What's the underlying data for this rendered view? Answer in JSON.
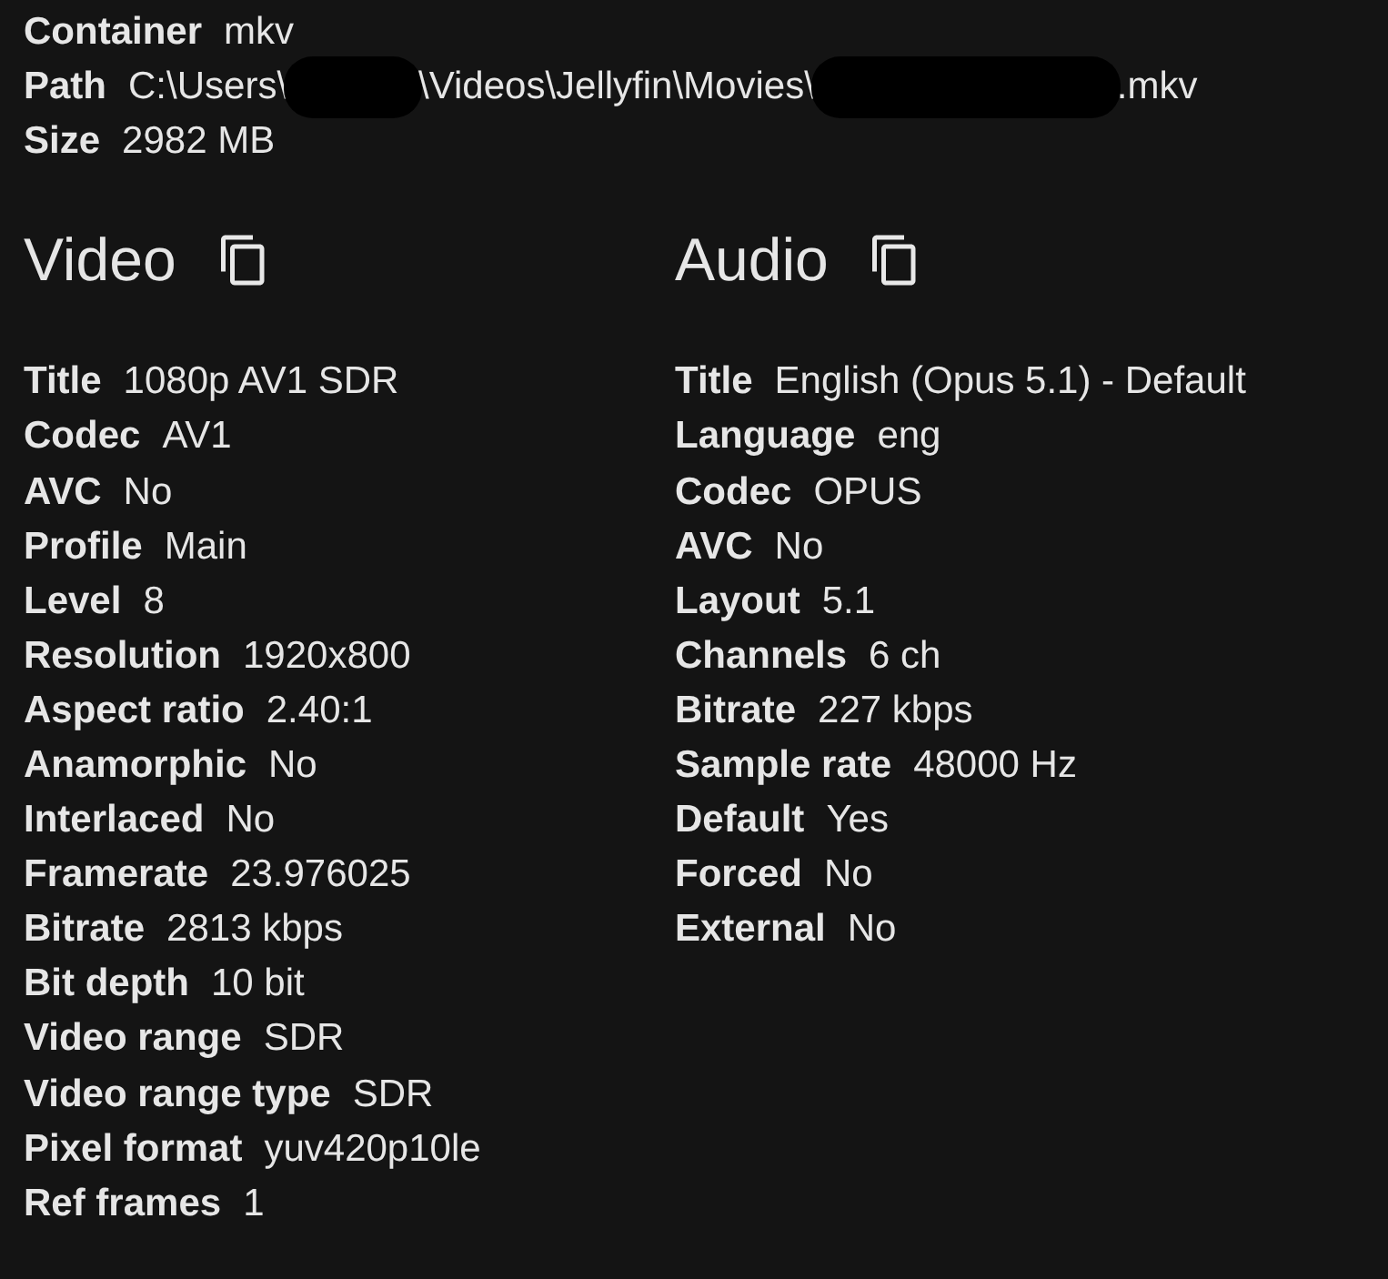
{
  "file_info": [
    {
      "label": "Container",
      "value": [
        {
          "kind": "text",
          "text": "mkv"
        }
      ]
    },
    {
      "label": "Path",
      "value": [
        {
          "kind": "text",
          "text": "C:\\Users\\"
        },
        {
          "kind": "redacted"
        },
        {
          "kind": "text",
          "text": "\\Videos\\Jellyfin\\Movies\\"
        },
        {
          "kind": "redacted"
        },
        {
          "kind": "text",
          "text": ".mkv"
        }
      ]
    },
    {
      "label": "Size",
      "value": [
        {
          "kind": "text",
          "text": "2982 MB"
        }
      ]
    }
  ],
  "streams": [
    {
      "heading": "Video",
      "rows": [
        {
          "label": "Title",
          "value": "1080p AV1 SDR"
        },
        {
          "label": "Codec",
          "value": "AV1"
        },
        {
          "label": "AVC",
          "value": "No"
        },
        {
          "label": "Profile",
          "value": "Main"
        },
        {
          "label": "Level",
          "value": "8"
        },
        {
          "label": "Resolution",
          "value": "1920x800"
        },
        {
          "label": "Aspect ratio",
          "value": "2.40:1"
        },
        {
          "label": "Anamorphic",
          "value": "No"
        },
        {
          "label": "Interlaced",
          "value": "No"
        },
        {
          "label": "Framerate",
          "value": "23.976025"
        },
        {
          "label": "Bitrate",
          "value": "2813 kbps"
        },
        {
          "label": "Bit depth",
          "value": "10 bit"
        },
        {
          "label": "Video range",
          "value": "SDR"
        },
        {
          "label": "Video range type",
          "value": "SDR"
        },
        {
          "label": "Pixel format",
          "value": "yuv420p10le"
        },
        {
          "label": "Ref frames",
          "value": "1"
        }
      ]
    },
    {
      "heading": "Audio",
      "rows": [
        {
          "label": "Title",
          "value": "English (Opus 5.1) - Default"
        },
        {
          "label": "Language",
          "value": "eng"
        },
        {
          "label": "Codec",
          "value": "OPUS"
        },
        {
          "label": "AVC",
          "value": "No"
        },
        {
          "label": "Layout",
          "value": "5.1"
        },
        {
          "label": "Channels",
          "value": "6 ch"
        },
        {
          "label": "Bitrate",
          "value": "227 kbps"
        },
        {
          "label": "Sample rate",
          "value": "48000 Hz"
        },
        {
          "label": "Default",
          "value": "Yes"
        },
        {
          "label": "Forced",
          "value": "No"
        },
        {
          "label": "External",
          "value": "No"
        }
      ]
    }
  ]
}
